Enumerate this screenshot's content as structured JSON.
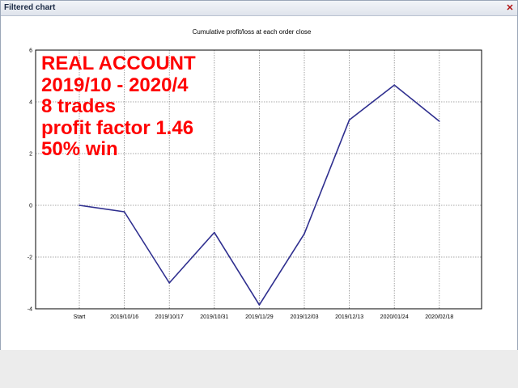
{
  "window": {
    "title": "Filtered chart",
    "close_icon": "close-icon"
  },
  "annotation": {
    "lines": [
      "REAL ACCOUNT",
      "2019/10 - 2020/4",
      "8 trades",
      "profit factor 1.46",
      "50% win"
    ],
    "color": "#ff0000"
  },
  "chart_data": {
    "type": "line",
    "title": "Cumulative profit/loss at each order close",
    "xlabel": "",
    "ylabel": "",
    "categories": [
      "Start",
      "2019/10/16",
      "2019/10/17",
      "2019/10/31",
      "2019/11/29",
      "2019/12/03",
      "2019/12/13",
      "2020/01/24",
      "2020/02/18"
    ],
    "series": [
      {
        "values": [
          0,
          -0.25,
          -3.0,
          -1.05,
          -3.85,
          -1.1,
          3.3,
          4.65,
          3.25
        ]
      }
    ],
    "yticks": [
      "6",
      "4",
      "2",
      "0",
      "-2",
      "-4"
    ],
    "ylim": [
      -4,
      6
    ],
    "grid": true,
    "line_color": "#2f2f8f"
  }
}
